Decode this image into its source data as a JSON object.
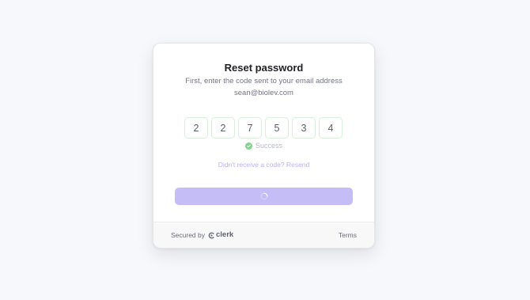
{
  "card": {
    "title": "Reset password",
    "subtitle": "First, enter the code sent to your email address",
    "email": "sean@biolev.com"
  },
  "otp": {
    "digits": [
      "2",
      "2",
      "7",
      "5",
      "3",
      "4"
    ],
    "status_icon": "check-circle-icon",
    "status_text": "Success",
    "status_color": "#7fd38a"
  },
  "resend": {
    "label": "Didn't receive a code? Resend"
  },
  "continue_button": {
    "state": "loading",
    "icon": "spinner-icon",
    "color": "#c4bdf6"
  },
  "footer": {
    "secured_label": "Secured by",
    "brand_name": "clerk",
    "brand_icon": "clerk-logo-icon",
    "terms_label": "Terms"
  },
  "colors": {
    "accent": "#6c47ff",
    "success": "#7fd38a",
    "page_background": "#f7f8fb"
  }
}
